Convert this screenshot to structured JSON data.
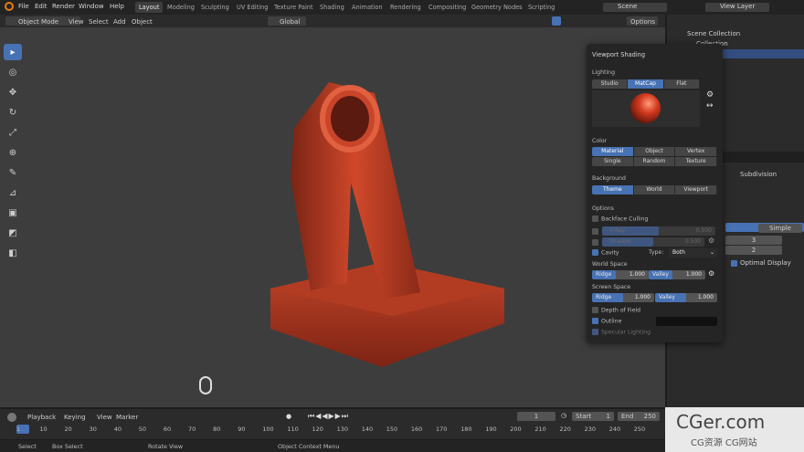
{
  "menus": [
    "File",
    "Edit",
    "Render",
    "Window",
    "Help"
  ],
  "workspaces": [
    "Layout",
    "Modeling",
    "Sculpting",
    "UV Editing",
    "Texture Paint",
    "Shading",
    "Animation",
    "Rendering",
    "Compositing",
    "Geometry Nodes",
    "Scripting"
  ],
  "scene": "Scene",
  "view_layer": "View Layer",
  "header": {
    "mode": "Object Mode",
    "menus": [
      "View",
      "Select",
      "Add",
      "Object"
    ],
    "orientation": "Global",
    "options": "Options"
  },
  "outliner": {
    "root": "Scene Collection",
    "collection": "Collection"
  },
  "properties": {
    "modifier": "Subdivision",
    "tab_b": "Simple",
    "value1": "3",
    "value2": "2",
    "optimal": "Optimal Display"
  },
  "shading": {
    "title": "Viewport Shading",
    "lighting_label": "Lighting",
    "lighting": [
      "Studio",
      "MatCap",
      "Flat"
    ],
    "color_label": "Color",
    "color": [
      "Material",
      "Object",
      "Vertex",
      "Single",
      "Random",
      "Texture"
    ],
    "background_label": "Background",
    "background": [
      "Theme",
      "World",
      "Viewport"
    ],
    "options_label": "Options",
    "backface": "Backface Culling",
    "xray": "X-Ray",
    "xray_val": "0.500",
    "shadow": "Shadow",
    "shadow_val": "0.500",
    "cavity": "Cavity",
    "type_label": "Type:",
    "type_val": "Both",
    "world_space": "World Space",
    "ridge": "Ridge",
    "ws_ridge": "1.000",
    "valley": "Valley",
    "ws_valley": "1.000",
    "screen_space": "Screen Space",
    "ss_ridge": "1.000",
    "ss_valley": "1.000",
    "dof": "Depth of Field",
    "outline": "Outline",
    "specular": "Specular Lighting"
  },
  "timeline": {
    "playback": "Playback",
    "keying": "Keying",
    "view": "View",
    "marker": "Marker",
    "current": "1",
    "start_label": "Start",
    "start": "1",
    "end_label": "End",
    "end": "250",
    "ticks": [
      "1",
      "10",
      "20",
      "30",
      "40",
      "50",
      "60",
      "70",
      "80",
      "90",
      "100",
      "110",
      "120",
      "130",
      "140",
      "150",
      "160",
      "170",
      "180",
      "190",
      "200",
      "210",
      "220",
      "230",
      "240",
      "250"
    ]
  },
  "status": {
    "select": "Select",
    "box": "Box Select",
    "rotate": "Rotate View",
    "context": "Object Context Menu"
  },
  "watermark": {
    "line1": "CGer.com",
    "line2": "CG资源 CG网站"
  }
}
